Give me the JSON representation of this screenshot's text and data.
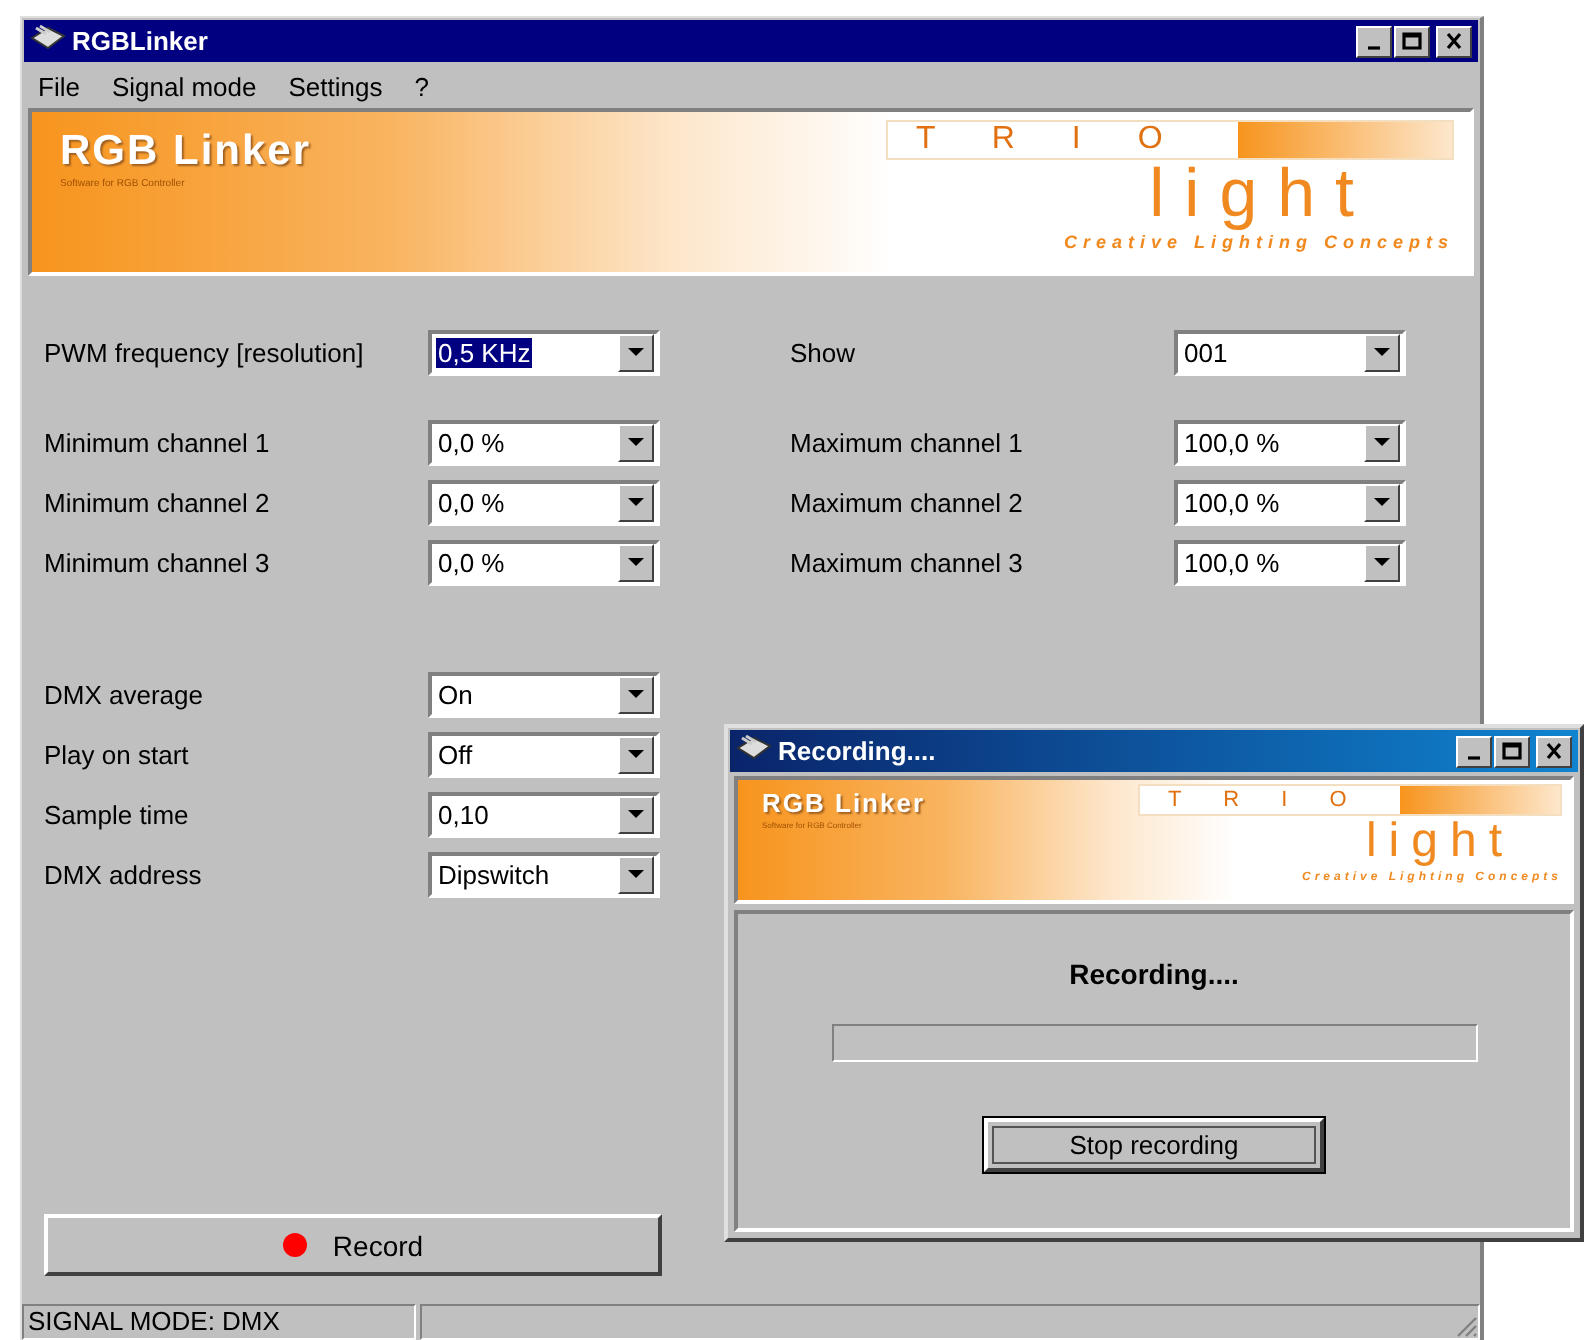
{
  "window": {
    "title": "RGBLinker"
  },
  "menu": [
    {
      "label": "File"
    },
    {
      "label": "Signal mode"
    },
    {
      "label": "Settings"
    },
    {
      "label": "?"
    }
  ],
  "banner": {
    "product": "RGB Linker",
    "tagline": "Software for RGB Controller",
    "brand_top": "T R I O",
    "brand": "light",
    "slogan": "Creative Lighting Concepts"
  },
  "groups": [
    [
      {
        "left": {
          "label": "PWM frequency [resolution]",
          "value": "0,5 KHz",
          "focused": true
        },
        "right": {
          "label": "Show",
          "value": "001",
          "focused": false
        }
      }
    ],
    [
      {
        "left": {
          "label": "Minimum channel 1",
          "value": "0,0 %",
          "focused": false
        },
        "right": {
          "label": "Maximum channel 1",
          "value": "100,0 %",
          "focused": false
        }
      },
      {
        "left": {
          "label": "Minimum channel 2",
          "value": "0,0 %",
          "focused": false
        },
        "right": {
          "label": "Maximum channel 2",
          "value": "100,0 %",
          "focused": false
        }
      },
      {
        "left": {
          "label": "Minimum channel 3",
          "value": "0,0 %",
          "focused": false
        },
        "right": {
          "label": "Maximum channel 3",
          "value": "100,0 %",
          "focused": false
        }
      }
    ],
    [
      {
        "left": {
          "label": "DMX average",
          "value": "On",
          "focused": false
        }
      },
      {
        "left": {
          "label": "Play on start",
          "value": "Off",
          "focused": false
        }
      },
      {
        "left": {
          "label": "Sample time",
          "value": "0,10",
          "focused": false
        }
      },
      {
        "left": {
          "label": "DMX address",
          "value": "Dipswitch",
          "focused": false
        }
      }
    ]
  ],
  "record_button": {
    "label": "Record"
  },
  "status_bar": [
    "SIGNAL MODE: DMX"
  ],
  "dialog": {
    "title": "Recording....",
    "banner": {
      "product": "RGB Linker",
      "tagline": "Software for RGB Controller",
      "brand_top": "T R I O",
      "brand": "light",
      "slogan": "Creative Lighting Concepts"
    },
    "message": "Recording....",
    "progress": {
      "level": 0
    },
    "button": {
      "label": "Stop recording",
      "focused": true
    }
  }
}
